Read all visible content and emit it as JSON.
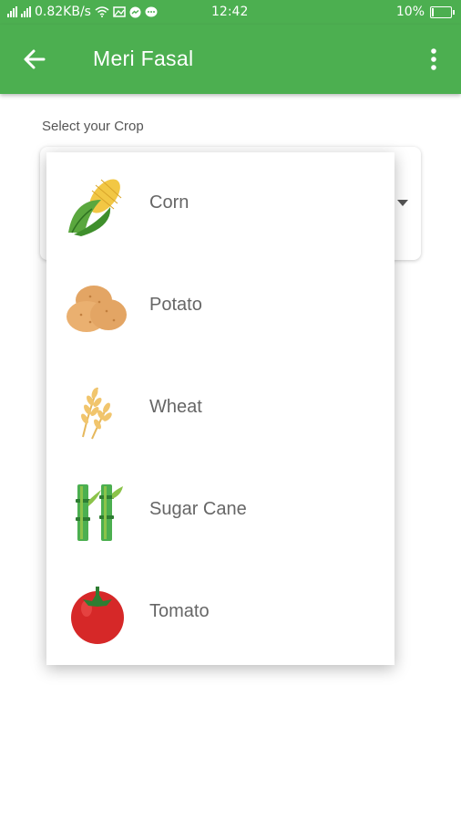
{
  "status_bar": {
    "net_speed": "0.82KB/s",
    "time": "12:42",
    "battery": "10%",
    "battery_level": 0.1
  },
  "app_bar": {
    "title": "Meri Fasal",
    "back_icon": "arrow-left-icon",
    "menu_icon": "more-vertical-icon"
  },
  "form": {
    "label": "Select your Crop"
  },
  "crops": [
    {
      "name": "Corn",
      "icon": "corn-icon"
    },
    {
      "name": "Potato",
      "icon": "potato-icon"
    },
    {
      "name": "Wheat",
      "icon": "wheat-icon"
    },
    {
      "name": "Sugar Cane",
      "icon": "sugar-cane-icon"
    },
    {
      "name": "Tomato",
      "icon": "tomato-icon"
    }
  ],
  "colors": {
    "primary": "#4caf50"
  }
}
